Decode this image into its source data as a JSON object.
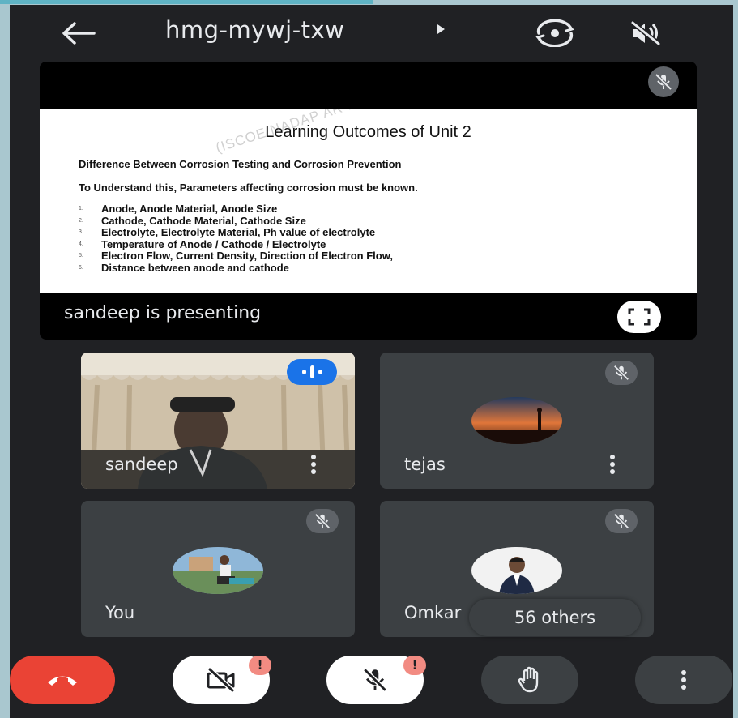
{
  "meeting": {
    "code": "hmg-mywj-txw"
  },
  "presentation": {
    "presenter_label": "sandeep is presenting",
    "slide": {
      "title": "Learning Outcomes of Unit 2",
      "line1": "Difference Between Corrosion Testing and Corrosion Prevention",
      "line2": "To Understand this, Parameters affecting corrosion must be known.",
      "items": [
        "Anode, Anode Material, Anode Size",
        "Cathode, Cathode Material, Cathode Size",
        "Electrolyte, Electrolyte Material, Ph value of electrolyte",
        "Temperature of Anode / Cathode / Electrolyte",
        "Electron Flow, Current Density, Direction of Electron Flow,",
        "Distance between anode and cathode"
      ],
      "watermark": "(ISCOE NADAP AR PUNE)"
    }
  },
  "participants": [
    {
      "name": "sandeep"
    },
    {
      "name": "tejas"
    },
    {
      "name": "You"
    },
    {
      "name": "Omkar"
    }
  ],
  "others_label": "56 others",
  "controls": {
    "camera_alert": "!",
    "mic_alert": "!"
  },
  "colors": {
    "background": "#202124",
    "tile": "#3c4043",
    "end_call": "#ea4335",
    "speaking": "#1a73e8",
    "alert": "#f28b82"
  },
  "icons": [
    "back-arrow-icon",
    "play-caret-icon",
    "switch-camera-icon",
    "speaker-off-icon",
    "mic-off-icon",
    "fullscreen-icon",
    "more-vert-icon",
    "end-call-icon",
    "camera-off-icon",
    "raise-hand-icon"
  ]
}
